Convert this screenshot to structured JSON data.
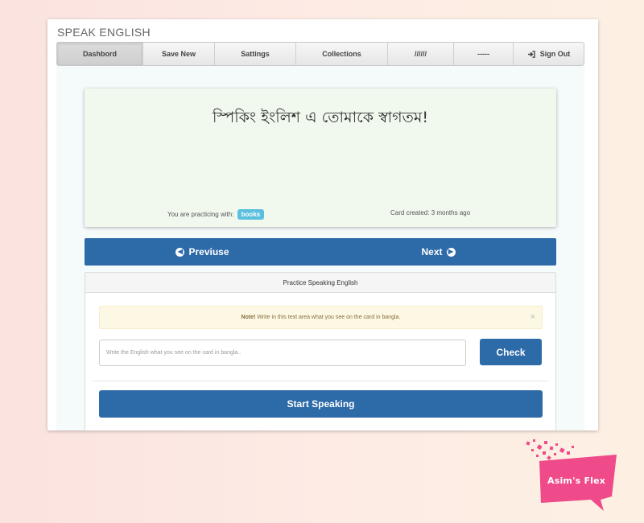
{
  "app": {
    "title": "SPEAK ENGLISH"
  },
  "nav": {
    "items": [
      {
        "label": "Dashbord",
        "active": true
      },
      {
        "label": "Save New"
      },
      {
        "label": "Sattings"
      },
      {
        "label": "Collections"
      },
      {
        "label": "//////"
      },
      {
        "label": "-----"
      },
      {
        "label": "Sign Out",
        "icon": "sign-out-icon"
      }
    ]
  },
  "card": {
    "text": "স্পিকিং ইংলিশ এ তোমাকে স্বাগতম!",
    "practicing_label": "You are practicing with:",
    "collection_tag": "books",
    "created_label": "Card created: 3 months ago"
  },
  "pager": {
    "prev_label": "Previuse",
    "prev_icon": "arrow-circle-left-icon",
    "next_label": "Next",
    "next_icon": "arrow-circle-right-icon"
  },
  "practice": {
    "heading": "Practice Speaking English",
    "alert_strong": "Note!",
    "alert_text": " Write in this text area what you see on the card in bangla.",
    "alert_close": "×",
    "input_placeholder": "Write the English what you see on the card in bangla..",
    "check_label": "Check",
    "start_label": "Start Speaking"
  },
  "brand": {
    "label": "Asim's Flex",
    "color": "#ef4a8a"
  },
  "colors": {
    "primary": "#2d6aa8",
    "card_bg": "#f1f8ee",
    "tag": "#5bc0de",
    "alert_bg": "#fcf8e3"
  }
}
